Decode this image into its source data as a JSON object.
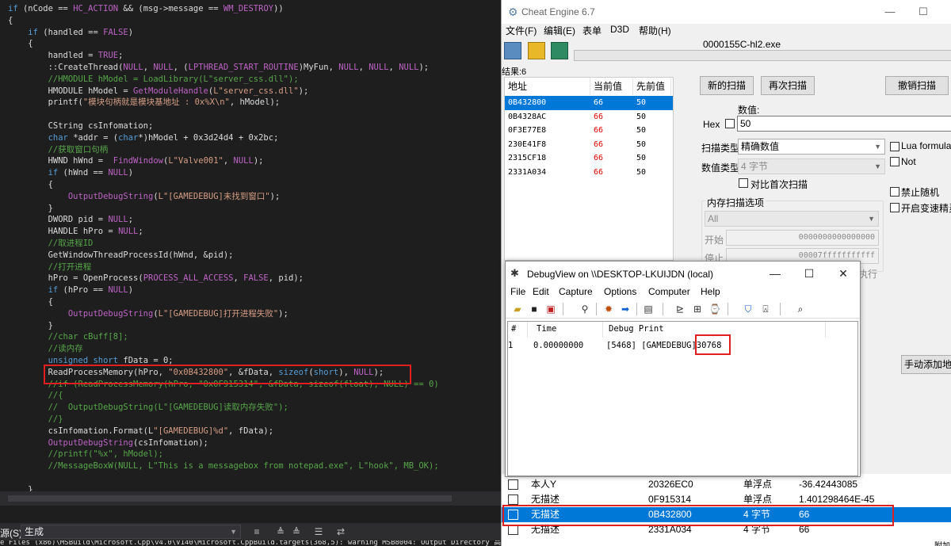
{
  "editor": {
    "lines": [
      [
        [
          "kw",
          "if"
        ],
        [
          "pl",
          " (nCode == "
        ],
        [
          "mac",
          "HC_ACTION"
        ],
        [
          "pl",
          " && (msg->message == "
        ],
        [
          "mac",
          "WM_DESTROY"
        ],
        [
          "pl",
          "))"
        ]
      ],
      [
        [
          "pl",
          "{"
        ]
      ],
      [
        [
          "pl",
          "    "
        ],
        [
          "kw",
          "if"
        ],
        [
          "pl",
          " (handled == "
        ],
        [
          "mac",
          "FALSE"
        ],
        [
          "pl",
          ")"
        ]
      ],
      [
        [
          "pl",
          "    {"
        ]
      ],
      [
        [
          "pl",
          "        handled = "
        ],
        [
          "mac",
          "TRUE"
        ],
        [
          "pl",
          ";"
        ]
      ],
      [
        [
          "pl",
          "        ::CreateThread("
        ],
        [
          "mac",
          "NULL"
        ],
        [
          "pl",
          ", "
        ],
        [
          "mac",
          "NULL"
        ],
        [
          "pl",
          ", ("
        ],
        [
          "mac",
          "LPTHREAD_START_ROUTINE"
        ],
        [
          "pl",
          ")MyFun, "
        ],
        [
          "mac",
          "NULL"
        ],
        [
          "pl",
          ", "
        ],
        [
          "mac",
          "NULL"
        ],
        [
          "pl",
          ", "
        ],
        [
          "mac",
          "NULL"
        ],
        [
          "pl",
          ");"
        ]
      ],
      [
        [
          "cm",
          "        //HMODULE hModel = LoadLibrary(L\"server_css.dll\");"
        ]
      ],
      [
        [
          "pl",
          "        HMODULE hModel = "
        ],
        [
          "mac",
          "GetModuleHandle"
        ],
        [
          "pl",
          "("
        ],
        [
          "str",
          "L\"server_css.dll\""
        ],
        [
          "pl",
          ");"
        ]
      ],
      [
        [
          "pl",
          "        printf("
        ],
        [
          "str",
          "\"模块句柄就是模块基地址 : 0x%X\\n\""
        ],
        [
          "pl",
          ", hModel);"
        ]
      ],
      [
        [
          "pl",
          ""
        ]
      ],
      [
        [
          "pl",
          "        CString csInfomation;"
        ]
      ],
      [
        [
          "pl",
          "        "
        ],
        [
          "kw",
          "char"
        ],
        [
          "pl",
          " *addr = ("
        ],
        [
          "kw",
          "char"
        ],
        [
          "pl",
          "*)hModel + 0x3d24d4 + 0x2bc;"
        ]
      ],
      [
        [
          "cm",
          "        //获取窗口句柄"
        ]
      ],
      [
        [
          "pl",
          "        HWND hWnd =  "
        ],
        [
          "mac",
          "FindWindow"
        ],
        [
          "pl",
          "("
        ],
        [
          "str",
          "L\"Valve001\""
        ],
        [
          "pl",
          ", "
        ],
        [
          "mac",
          "NULL"
        ],
        [
          "pl",
          ");"
        ]
      ],
      [
        [
          "pl",
          "        "
        ],
        [
          "kw",
          "if"
        ],
        [
          "pl",
          " (hWnd == "
        ],
        [
          "mac",
          "NULL"
        ],
        [
          "pl",
          ")"
        ]
      ],
      [
        [
          "pl",
          "        {"
        ]
      ],
      [
        [
          "pl",
          "            "
        ],
        [
          "mac",
          "OutputDebugString"
        ],
        [
          "pl",
          "("
        ],
        [
          "str",
          "L\"[GAMEDEBUG]未找到窗口\""
        ],
        [
          "pl",
          ");"
        ]
      ],
      [
        [
          "pl",
          "        }"
        ]
      ],
      [
        [
          "pl",
          "        DWORD pid = "
        ],
        [
          "mac",
          "NULL"
        ],
        [
          "pl",
          ";"
        ]
      ],
      [
        [
          "pl",
          "        HANDLE hPro = "
        ],
        [
          "mac",
          "NULL"
        ],
        [
          "pl",
          ";"
        ]
      ],
      [
        [
          "cm",
          "        //取进程ID"
        ]
      ],
      [
        [
          "pl",
          "        GetWindowThreadProcessId(hWnd, &pid);"
        ]
      ],
      [
        [
          "cm",
          "        //打开进程"
        ]
      ],
      [
        [
          "pl",
          "        hPro = OpenProcess("
        ],
        [
          "mac",
          "PROCESS_ALL_ACCESS"
        ],
        [
          "pl",
          ", "
        ],
        [
          "mac",
          "FALSE"
        ],
        [
          "pl",
          ", pid);"
        ]
      ],
      [
        [
          "pl",
          "        "
        ],
        [
          "kw",
          "if"
        ],
        [
          "pl",
          " (hPro == "
        ],
        [
          "mac",
          "NULL"
        ],
        [
          "pl",
          ")"
        ]
      ],
      [
        [
          "pl",
          "        {"
        ]
      ],
      [
        [
          "pl",
          "            "
        ],
        [
          "mac",
          "OutputDebugString"
        ],
        [
          "pl",
          "("
        ],
        [
          "str",
          "L\"[GAMEDEBUG]打开进程失败\""
        ],
        [
          "pl",
          ");"
        ]
      ],
      [
        [
          "pl",
          "        }"
        ]
      ],
      [
        [
          "cm",
          "        //char cBuff[8];"
        ]
      ],
      [
        [
          "cm",
          "        //读内存"
        ]
      ],
      [
        [
          "pl",
          "        "
        ],
        [
          "kw",
          "unsigned short"
        ],
        [
          "pl",
          " fData = 0;"
        ]
      ],
      [
        [
          "pl",
          "        ReadProcessMemory(hPro, "
        ],
        [
          "str",
          "\"0x0B432800\""
        ],
        [
          "pl",
          ", &fData, "
        ],
        [
          "kw",
          "sizeof"
        ],
        [
          "pl",
          "("
        ],
        [
          "kw",
          "short"
        ],
        [
          "pl",
          "), "
        ],
        [
          "mac",
          "NULL"
        ],
        [
          "pl",
          ");"
        ]
      ],
      [
        [
          "cm",
          "        //if (ReadProcessMemory(hPro, \"0x0F915314\", &fData, sizeof(float), NULL) == 0)"
        ]
      ],
      [
        [
          "cm",
          "        //{"
        ]
      ],
      [
        [
          "cm",
          "        //  OutputDebugString(L\"[GAMEDEBUG]读取内存失败\");"
        ]
      ],
      [
        [
          "cm",
          "        //}"
        ]
      ],
      [
        [
          "pl",
          "        csInfomation.Format(L"
        ],
        [
          "str",
          "\"[GAMEDEBUG]%d\""
        ],
        [
          "pl",
          ", fData);"
        ]
      ],
      [
        [
          "pl",
          "        "
        ],
        [
          "mac",
          "OutputDebugString"
        ],
        [
          "pl",
          "(csInfomation);"
        ]
      ],
      [
        [
          "cm",
          "        //printf(\"%x\", hModel);"
        ]
      ],
      [
        [
          "cm",
          "        //MessageBoxW(NULL, L\"This is a messagebox from notepad.exe\", L\"hook\", MB_OK);"
        ]
      ],
      [
        [
          "pl",
          ""
        ]
      ],
      [
        [
          "pl",
          "    }"
        ]
      ]
    ]
  },
  "output_bar": {
    "label": "源(S):",
    "source_value": "生成",
    "log_line": "e Files (x86)\\MSBuild\\Microsoft.Cpp\\v4.0\\V140\\Microsoft.CppBuild.targets(368,5): warning MSB8004: Output Directory 高级选项"
  },
  "cheat_engine": {
    "title": "Cheat Engine 6.7",
    "menu": [
      "文件(F)",
      "编辑(E)",
      "表单",
      "D3D",
      "帮助(H)"
    ],
    "process_name": "0000155C-hl2.exe",
    "results_label": "结果:6",
    "columns": [
      "地址",
      "当前值",
      "先前值"
    ],
    "results": [
      {
        "address": "0B432800",
        "current": "66",
        "previous": "50"
      },
      {
        "address": "0B4328AC",
        "current": "66",
        "previous": "50"
      },
      {
        "address": "0F3E77E8",
        "current": "66",
        "previous": "50"
      },
      {
        "address": "230E41F8",
        "current": "66",
        "previous": "50"
      },
      {
        "address": "2315CF18",
        "current": "66",
        "previous": "50"
      },
      {
        "address": "2331A034",
        "current": "66",
        "previous": "50"
      }
    ],
    "buttons": {
      "new_scan": "新的扫描",
      "next_scan": "再次扫描",
      "undo_scan": "撤销扫描",
      "add_address": "手动添加地址"
    },
    "value_label": "数值:",
    "hex_label": "Hex",
    "value_input": "50",
    "scan_type_label": "扫描类型",
    "scan_type_value": "精确数值",
    "value_type_label": "数值类型",
    "value_type_value": "4 字节",
    "compare_first_label": "对比首次扫描",
    "memory_options_label": "内存扫描选项",
    "memory_region": "All",
    "start_label": "开始",
    "start_value": "0000000000000000",
    "stop_label": "停止",
    "stop_value": "00007fffffffffff",
    "execute_label": "执行",
    "lua_formula": "Lua formula",
    "not_label": "Not",
    "disable_random": "禁止随机",
    "speedhack": "开启变速精灵",
    "address_list": [
      {
        "desc": "本人Y",
        "address": "20326EC0",
        "type": "单浮点",
        "value": "-36.42443085"
      },
      {
        "desc": "无描述",
        "address": "0F915314",
        "type": "单浮点",
        "value": "1.401298464E-45"
      },
      {
        "desc": "无描述",
        "address": "0B432800",
        "type": "4 字节",
        "value": "66"
      },
      {
        "desc": "无描述",
        "address": "2331A034",
        "type": "4 字节",
        "value": "66"
      }
    ],
    "attach_label": "附加"
  },
  "debugview": {
    "title": "DebugView on \\\\DESKTOP-LKUIJDN (local)",
    "menu": [
      "File",
      "Edit",
      "Capture",
      "Options",
      "Computer",
      "Help"
    ],
    "columns": [
      "#",
      "Time",
      "Debug Print"
    ],
    "entry": {
      "index": "1",
      "time": "0.00000000",
      "print_prefix": "[5468] [GAMEDEBUG]",
      "print_value": "30768"
    }
  }
}
